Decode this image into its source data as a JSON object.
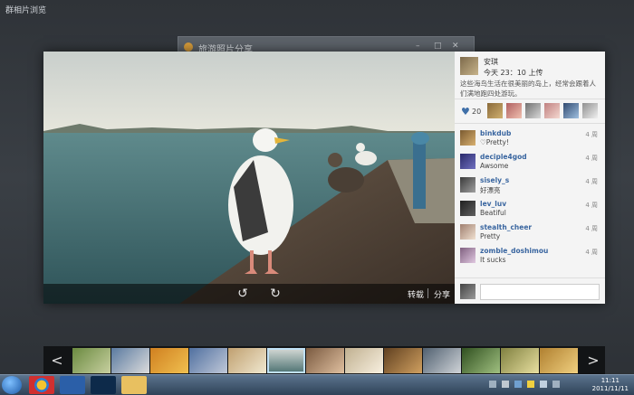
{
  "app": {
    "title": "群相片浏览"
  },
  "background_window": {
    "title": "旅游照片分享"
  },
  "photo_bar": {
    "forward_label": "转载",
    "share_label": "分享",
    "rotate_left_icon": "rotate-left-icon",
    "rotate_right_icon": "rotate-right-icon"
  },
  "panel": {
    "poster_name": "安琪",
    "post_time": "今天 23：10 上传",
    "description": "这些海鸟生活在很美丽的岛上，经常会跟着人们满地跑四处游玩。",
    "likes": {
      "count": "20",
      "icon": "heart-icon"
    },
    "comments": [
      {
        "user": "binkdub",
        "text": "♡Pretty!",
        "time": "4 周"
      },
      {
        "user": "deciple4god",
        "text": "Awsome",
        "time": "4 周"
      },
      {
        "user": "sisely_s",
        "text": "好漂亮",
        "time": "4 周"
      },
      {
        "user": "lev_luv",
        "text": "Beatiful",
        "time": "4 周"
      },
      {
        "user": "stealth_cheer",
        "text": "Pretty",
        "time": "4 周"
      },
      {
        "user": "zomble_doshimou",
        "text": "It sucks",
        "time": "4 周"
      }
    ],
    "reply_placeholder": ""
  },
  "filmstrip": {
    "prev_label": "<",
    "next_label": ">"
  },
  "taskbar": {
    "clock_time": "11:11",
    "clock_date": "2011/11/11"
  },
  "colors": {
    "accent": "#3a66a0",
    "taskbar": "#3f566e"
  }
}
